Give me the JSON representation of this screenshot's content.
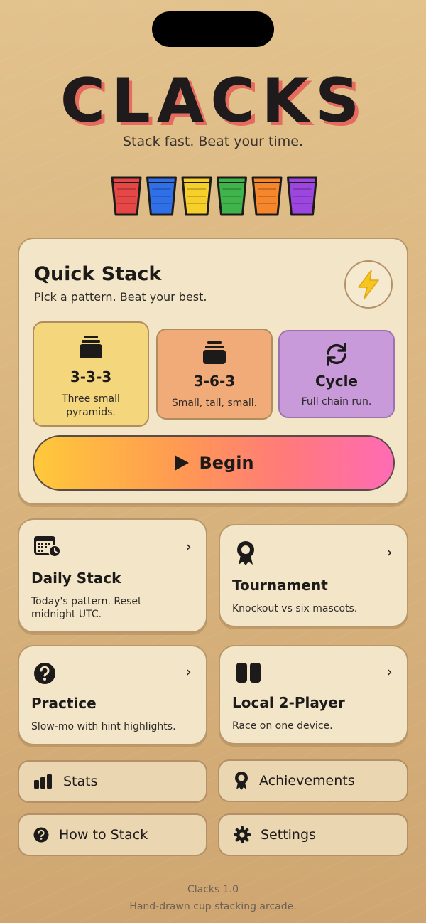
{
  "app": {
    "title": "CLACKS",
    "tagline": "Stack fast. Beat your time."
  },
  "cups": {
    "colors": [
      "#e54646",
      "#2f6fe8",
      "#f7cf2a",
      "#3fb44a",
      "#f6862c",
      "#9d45df"
    ]
  },
  "quick_stack": {
    "title": "Quick Stack",
    "subtitle": "Pick a pattern. Beat your best.",
    "icon": "lightning-icon",
    "patterns": [
      {
        "name": "3-3-3",
        "desc": "Three small pyramids.",
        "icon": "cup-stack-icon",
        "selected": true
      },
      {
        "name": "3-6-3",
        "desc": "Small, tall, small.",
        "icon": "cup-stack-icon"
      },
      {
        "name": "Cycle",
        "desc": "Full chain run.",
        "icon": "cycle-icon"
      }
    ],
    "begin_label": "Begin"
  },
  "modes": [
    {
      "title": "Daily Stack",
      "desc": "Today's pattern. Reset midnight UTC.",
      "icon": "calendar-clock-icon"
    },
    {
      "title": "Tournament",
      "desc": "Knockout vs six mascots.",
      "icon": "ribbon-icon"
    },
    {
      "title": "Practice",
      "desc": "Slow-mo with hint highlights.",
      "icon": "question-icon"
    },
    {
      "title": "Local 2-Player",
      "desc": "Race on one device.",
      "icon": "split-screen-icon"
    }
  ],
  "menu": {
    "stats": "Stats",
    "achievements": "Achievements",
    "how_to_stack": "How to Stack",
    "settings": "Settings"
  },
  "footer": {
    "version": "Clacks 1.0",
    "tagline": "Hand-drawn cup stacking arcade."
  }
}
